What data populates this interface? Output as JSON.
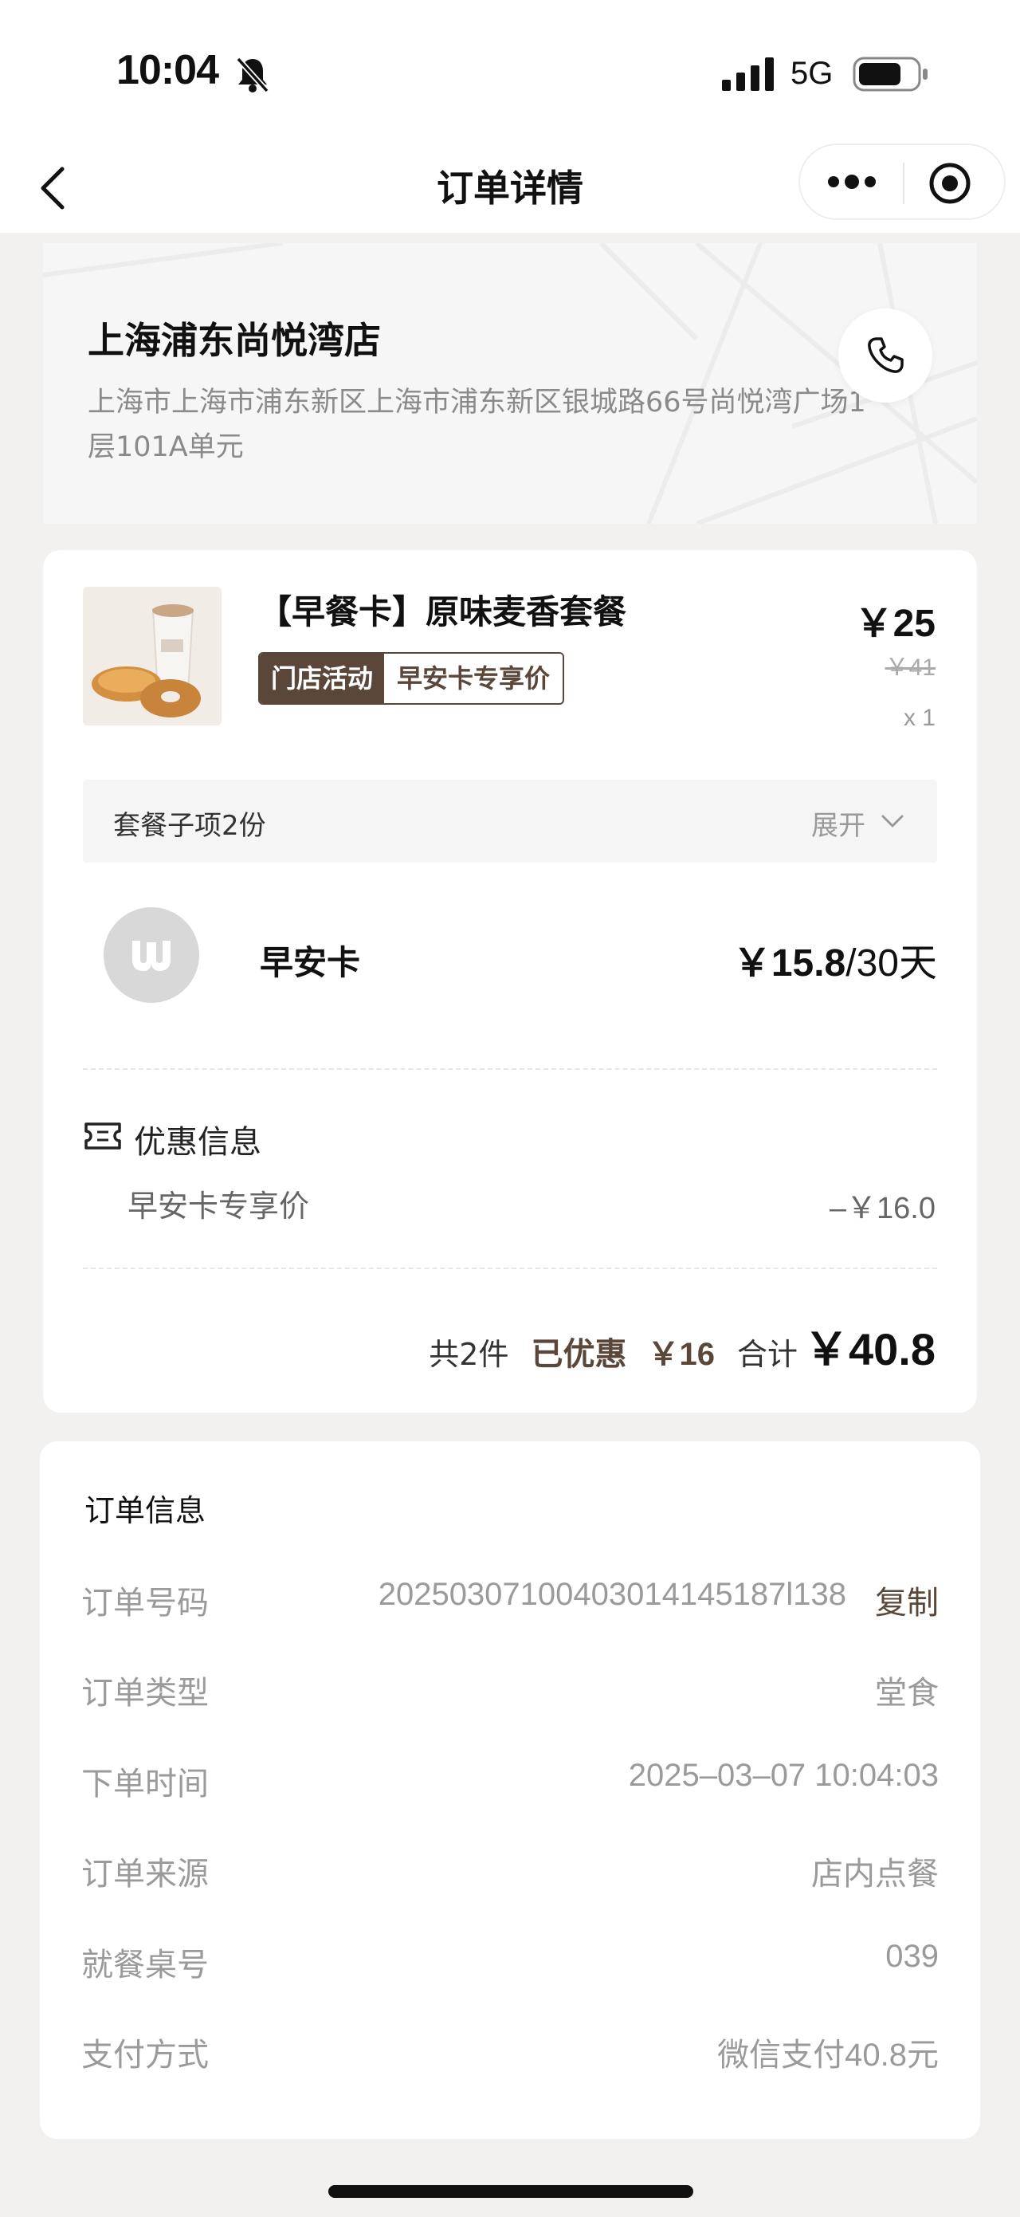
{
  "status_bar": {
    "time": "10:04",
    "network": "5G"
  },
  "nav": {
    "title": "订单详情"
  },
  "store": {
    "name": "上海浦东尚悦湾店",
    "address": "上海市上海市浦东新区上海市浦东新区银城路66号尚悦湾广场1层101A单元"
  },
  "product": {
    "name": "【早餐卡】原味麦香套餐",
    "tag_activity": "门店活动",
    "tag_price": "早安卡专享价",
    "price": "￥25",
    "original_price": "￥41",
    "quantity": "x 1",
    "combo_label": "套餐子项2份",
    "combo_expand": "展开"
  },
  "member_card": {
    "name": "早安卡",
    "price": "￥15.8",
    "period": "/30天"
  },
  "discount": {
    "title": "优惠信息",
    "name": "早安卡专享价",
    "value": "–￥16.0"
  },
  "summary": {
    "count": "共2件",
    "saved_label": "已优惠",
    "saved_value": "￥16",
    "total_label": "合计",
    "total_value": "￥40.8"
  },
  "order_info": {
    "title": "订单信息",
    "copy_label": "复制",
    "rows": [
      {
        "label": "订单号码",
        "value": "20250307100403014145187l138"
      },
      {
        "label": "订单类型",
        "value": "堂食"
      },
      {
        "label": "下单时间",
        "value": "2025–03–07 10:04:03"
      },
      {
        "label": "订单来源",
        "value": "店内点餐"
      },
      {
        "label": "就餐桌号",
        "value": "039"
      },
      {
        "label": "支付方式",
        "value": "微信支付40.8元"
      }
    ]
  },
  "colors": {
    "brand": "#5a4739",
    "page_bg": "#f2f1f0",
    "muted_text": "#9a9a9a"
  },
  "icons": [
    "bell-off-icon",
    "signal-icon",
    "battery-icon",
    "back-icon",
    "more-icon",
    "target-icon",
    "phone-icon",
    "chevron-down-icon",
    "ticket-icon",
    "brand-logo-icon"
  ]
}
